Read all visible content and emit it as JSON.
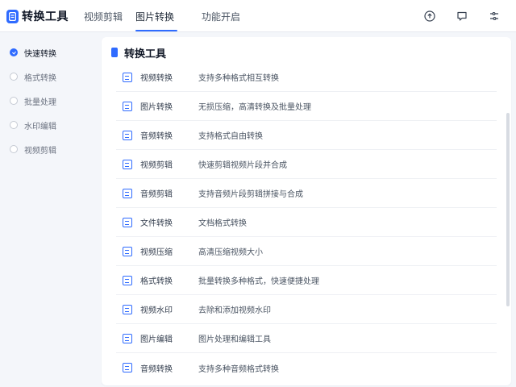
{
  "app": {
    "name": "转换工具"
  },
  "nav": {
    "tabs": [
      {
        "label": "视频剪辑"
      },
      {
        "label": "图片转换"
      },
      {
        "label": "功能开启"
      }
    ],
    "active_index": 1
  },
  "topbar_icons": [
    "upload-icon",
    "message-icon",
    "settings-icon"
  ],
  "sidebar": {
    "items": [
      {
        "label": "快速转换",
        "active": true
      },
      {
        "label": "格式转换",
        "active": false
      },
      {
        "label": "批量处理",
        "active": false
      },
      {
        "label": "水印编辑",
        "active": false
      },
      {
        "label": "视频剪辑",
        "active": false
      }
    ]
  },
  "panel": {
    "title": "转换工具",
    "rows": [
      {
        "name": "视频转换",
        "desc": "支持多种格式相互转换"
      },
      {
        "name": "图片转换",
        "desc": "无损压缩，高清转换及批量处理"
      },
      {
        "name": "音频转换",
        "desc": "支持格式自由转换"
      },
      {
        "name": "视频剪辑",
        "desc": "快速剪辑视频片段并合成"
      },
      {
        "name": "音频剪辑",
        "desc": "支持音频片段剪辑拼接与合成"
      },
      {
        "name": "文件转换",
        "desc": "文档格式转换"
      },
      {
        "name": "视频压缩",
        "desc": "高清压缩视频大小"
      },
      {
        "name": "格式转换",
        "desc": "批量转换多种格式，快速便捷处理"
      },
      {
        "name": "视频水印",
        "desc": "去除和添加视频水印"
      },
      {
        "name": "图片编辑",
        "desc": "图片处理和编辑工具"
      },
      {
        "name": "音频转换",
        "desc": "支持多种音频格式转换"
      }
    ]
  },
  "colors": {
    "accent": "#2f6bff",
    "background": "#f4f6fa",
    "panel": "#ffffff"
  }
}
